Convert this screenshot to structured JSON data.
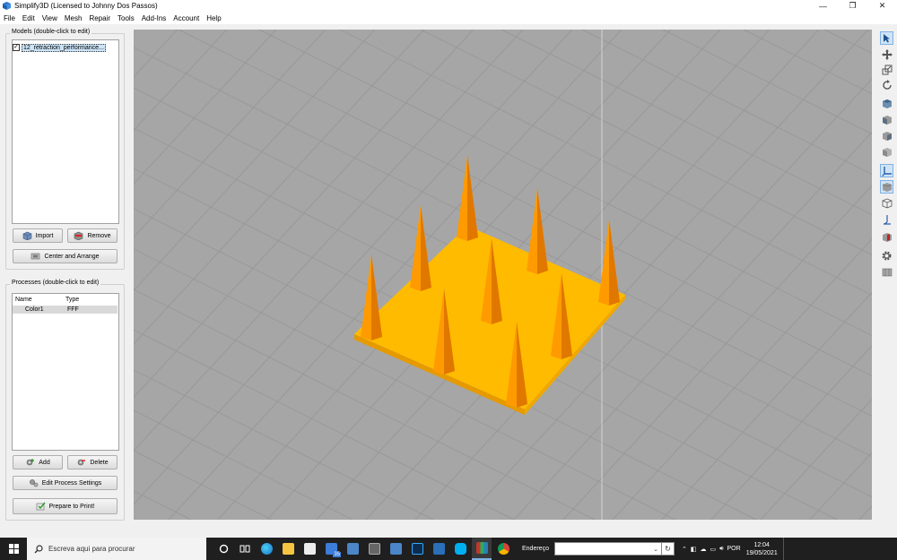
{
  "window": {
    "title": "Simplify3D (Licensed to Johnny Dos Passos)",
    "controls": {
      "minimize": "—",
      "restore": "❐",
      "close": "✕"
    }
  },
  "menu": [
    "File",
    "Edit",
    "View",
    "Mesh",
    "Repair",
    "Tools",
    "Add-Ins",
    "Account",
    "Help"
  ],
  "models_panel": {
    "label": "Models (double-click to edit)",
    "items": [
      {
        "name": "12_retraction_performance...",
        "checked": true
      }
    ],
    "import_label": "Import",
    "remove_label": "Remove",
    "center_label": "Center and Arrange"
  },
  "processes_panel": {
    "label": "Processes (double-click to edit)",
    "columns": [
      "Name",
      "Type"
    ],
    "rows": [
      {
        "name": "Color1",
        "type": "FFF"
      }
    ],
    "add_label": "Add",
    "delete_label": "Delete",
    "edit_label": "Edit Process Settings",
    "prepare_label": "Prepare to Print!"
  },
  "right_toolbar": [
    {
      "icon": "select-arrow-icon",
      "active": true
    },
    {
      "icon": "move-icon",
      "active": false
    },
    {
      "icon": "scale-icon",
      "active": false
    },
    {
      "icon": "rotate-icon",
      "active": false
    },
    {
      "icon": "view-cube-top-icon",
      "active": false
    },
    {
      "icon": "view-cube-front-icon",
      "active": false
    },
    {
      "icon": "view-cube-side-icon",
      "active": false
    },
    {
      "icon": "view-cube-iso-icon",
      "active": false
    },
    {
      "icon": "axes-icon",
      "active": true
    },
    {
      "icon": "solid-cube-icon",
      "active": true
    },
    {
      "icon": "wireframe-cube-icon",
      "active": false
    },
    {
      "icon": "origin-icon",
      "active": false
    },
    {
      "icon": "cross-section-icon",
      "active": false
    },
    {
      "icon": "settings-gear-icon",
      "active": false
    },
    {
      "icon": "print-bed-icon",
      "active": false
    }
  ],
  "colors": {
    "viewport_bg": "#a6a6a6",
    "grid_line": "#989898",
    "model_orange": "#ffb400",
    "model_shadow": "#e08a00",
    "selection_blue": "#cce4f7"
  },
  "taskbar": {
    "search_placeholder": "Escreva aqui para procurar",
    "address_label": "Endereço",
    "mail_badge": "35",
    "language": "POR",
    "time": "12:04",
    "date": "19/05/2021"
  }
}
